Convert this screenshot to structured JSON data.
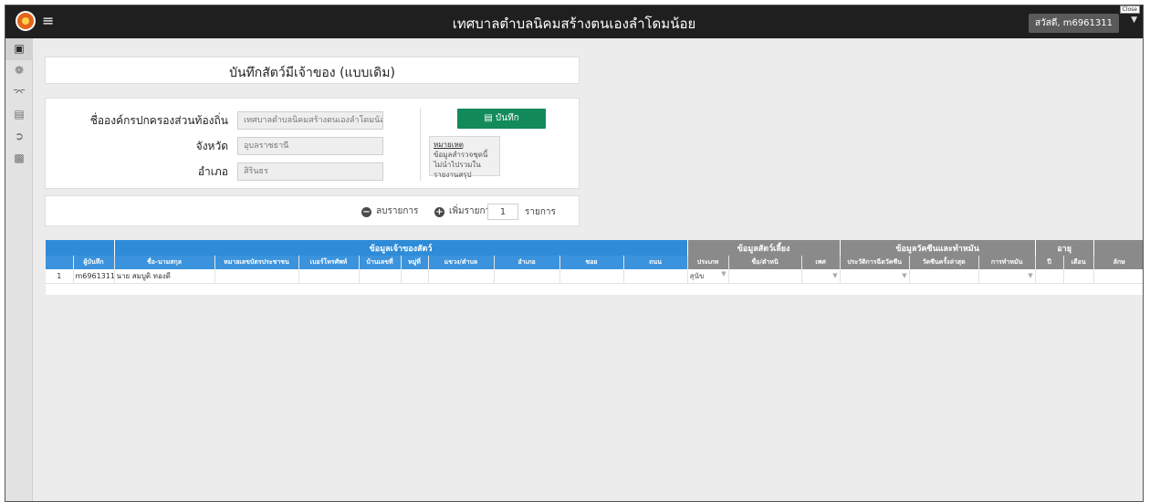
{
  "topbar": {
    "menu_icon": "hamburger-icon",
    "title": "เทศบาลตำบลนิคมสร้างตนเองลำโดมน้อย",
    "user": "สวัสดี, m6961311",
    "close_label": "Close"
  },
  "sidebar": {
    "items": [
      {
        "icon": "clipboard-icon",
        "active": true
      },
      {
        "icon": "paw-icon",
        "active": false
      },
      {
        "icon": "animal-icon",
        "active": false
      },
      {
        "icon": "document-icon",
        "active": false
      },
      {
        "icon": "sign-out-icon",
        "active": false
      },
      {
        "icon": "file-icon",
        "active": false
      }
    ]
  },
  "page": {
    "title": "บันทึกสัตว์มีเจ้าของ (แบบเดิม)"
  },
  "form": {
    "org_label": "ชื่อองค์กรปกครองส่วนท้องถิ่น",
    "org_value": "เทศบาลตำบลนิคมสร้างตนเองลำโดมน้อ",
    "province_label": "จังหวัด",
    "province_value": "อุบลราชธานี",
    "district_label": "อำเภอ",
    "district_value": "สิรินธร",
    "save_label": "บันทึก",
    "note_title": "หมายเหตุ",
    "note_text": "ข้อมูลสำรวจชุดนี้ ไม่นำไปรวมในรายงานสรุป"
  },
  "controls": {
    "remove_label": "ลบรายการ",
    "add_label": "เพิ่มรายการ",
    "count_value": "1",
    "count_unit": "รายการ"
  },
  "grid": {
    "groups": [
      {
        "label": "",
        "color": "#2e8bd8"
      },
      {
        "label": "ข้อมูลเจ้าของสัตว์",
        "color": "#2e8bd8"
      },
      {
        "label": "ข้อมูลสัตว์เลี้ยง",
        "color": "#8a8a8a"
      },
      {
        "label": "ข้อมูลวัคซีนและทำหมัน",
        "color": "#8a8a8a"
      },
      {
        "label": "อายุ",
        "color": "#8a8a8a"
      },
      {
        "label": "",
        "color": "#8a8a8a"
      }
    ],
    "columns": [
      "",
      "ผู้บันทึก",
      "ชื่อ-นามสกุล",
      "หมายเลขบัตรประชาชน",
      "เบอร์โทรศัพท์",
      "บ้านเลขที่",
      "หมู่ที่",
      "แขวง/ตำบล",
      "อำเภอ",
      "ซอย",
      "ถนน",
      "ประเภท",
      "ชื่อ/ตำหนิ",
      "เพศ",
      "ประวัติการฉีดวัคซีน",
      "วัคซีนครั้งล่าสุด",
      "การทำหมัน",
      "ปี",
      "เดือน",
      "ลักษ"
    ],
    "row": {
      "num": "1",
      "recorder": "m6961311",
      "name": "นาย สมบูติ ทองดี",
      "species": "สุนัข"
    }
  }
}
